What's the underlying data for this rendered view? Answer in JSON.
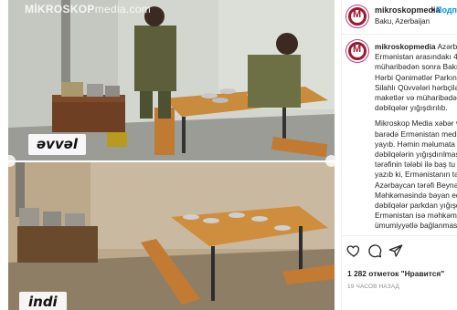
{
  "media": {
    "watermark_bold": "MİKROSKOP",
    "watermark_rest": "media.com",
    "top_caption": "əvvəl",
    "bottom_caption": "indi"
  },
  "post": {
    "username": "mikroskopmedia",
    "follow_separator": "•",
    "follow_label": "Подп",
    "location": "Baku, Azerbaijan"
  },
  "comment": {
    "username": "mikroskopmedia",
    "lines": [
      "Azərba",
      "Ermənistan arasındakı 44",
      "müharibədən sonra Bakı",
      "Hərbi Qənimətlər Parkınd",
      "Silahlı Qüvvələri hərbçilə",
      "maketlər və müharibədə",
      "dəbilqələr yığışdırılıb."
    ],
    "lines2": [
      "Mikroskop Media xəbər v",
      "barədə Ermənistan medi",
      "yayıb. Həmin məlumata",
      "dəbilqələrin yığışdırılmas",
      "tərəfinin tələbi ilə baş tu",
      "yazıb ki, Ermənistanın tə",
      "Azərbaycan tərəfi Beynəl",
      "Məhkəməsində bəyan ed",
      "dəbilqələr parkdan yığışd",
      "Ermənistan isə məhkəmə",
      "ümumiyyətlə bağlanmas"
    ]
  },
  "actions": {
    "likes_text": "1 282 отметок \"Нравится\"",
    "time_text": "19 ЧАСОВ НАЗАД"
  },
  "colors": {
    "brand": "#9b1a2e",
    "follow": "#0095f6"
  }
}
